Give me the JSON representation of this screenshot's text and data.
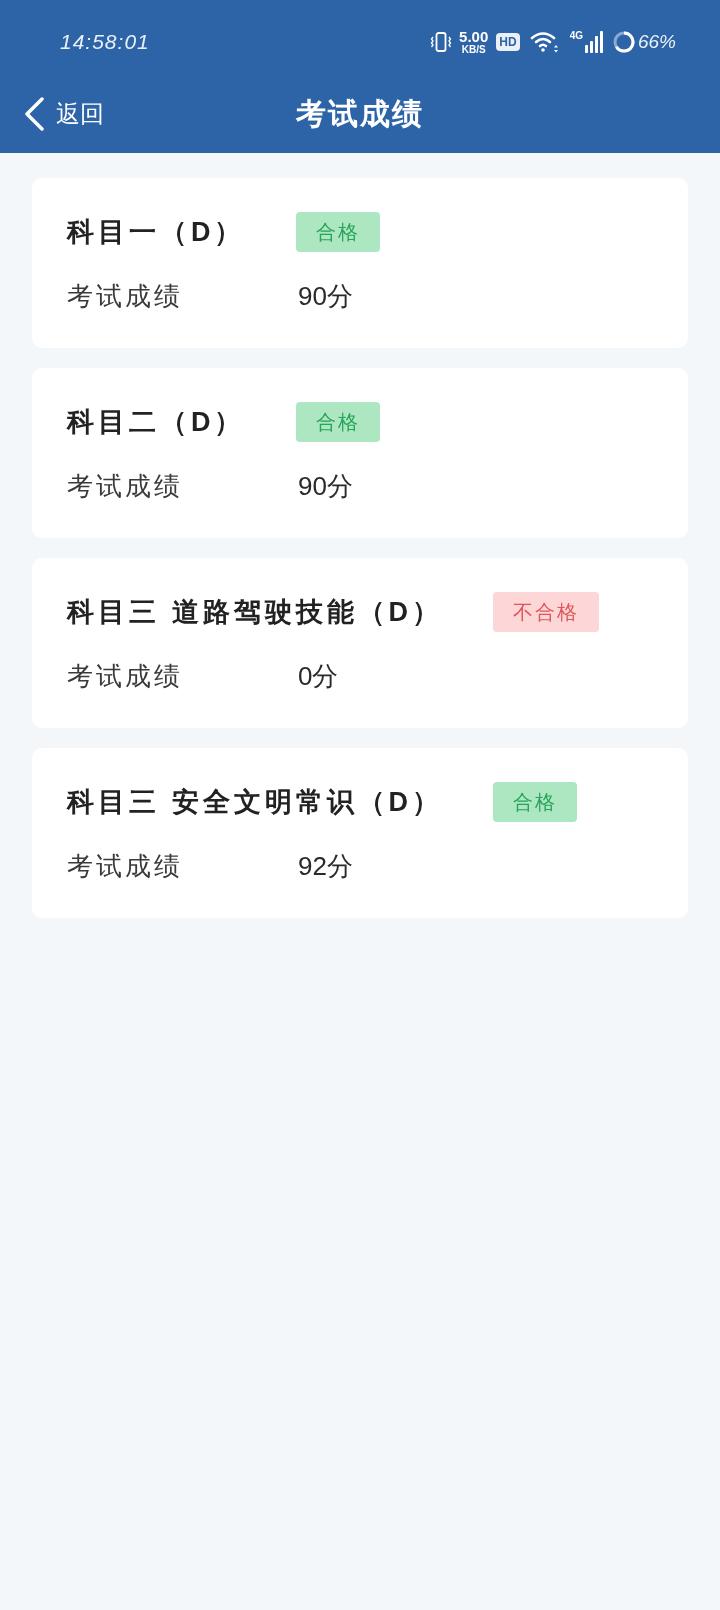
{
  "status_bar": {
    "time": "14:58:01",
    "net_speed": "5.00",
    "net_speed_unit": "KB/S",
    "hd_badge": "HD",
    "network_type": "4G",
    "battery": "66%"
  },
  "nav_bar": {
    "back_label": "返回",
    "title": "考试成绩"
  },
  "results": [
    {
      "subject": "科目一（D）",
      "status": "合格",
      "passed": true,
      "score_label": "考试成绩",
      "score": "90分"
    },
    {
      "subject": "科目二（D）",
      "status": "合格",
      "passed": true,
      "score_label": "考试成绩",
      "score": "90分"
    },
    {
      "subject": "科目三 道路驾驶技能（D）",
      "status": "不合格",
      "passed": false,
      "score_label": "考试成绩",
      "score": "0分"
    },
    {
      "subject": "科目三 安全文明常识（D）",
      "status": "合格",
      "passed": true,
      "score_label": "考试成绩",
      "score": "92分"
    }
  ]
}
